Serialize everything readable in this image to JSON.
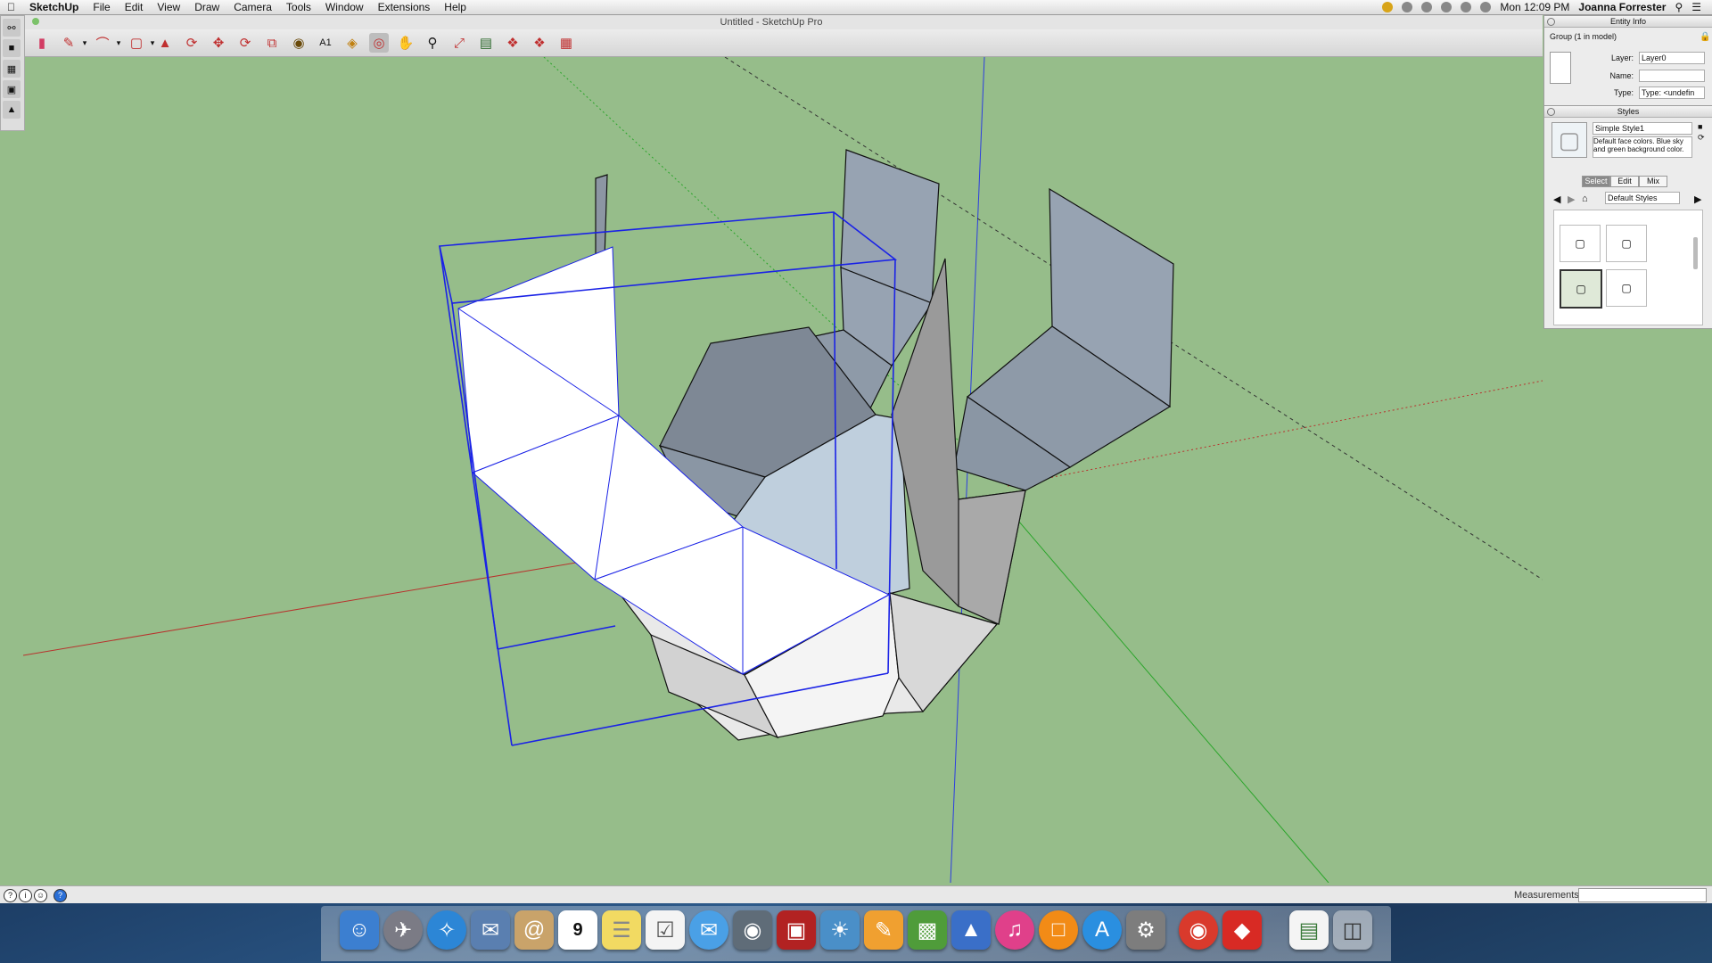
{
  "menubar": {
    "apple": "",
    "app_name": "SketchUp",
    "items": [
      "File",
      "Edit",
      "View",
      "Draw",
      "Camera",
      "Tools",
      "Window",
      "Extensions",
      "Help"
    ],
    "clock": "Mon 12:09 PM",
    "user": "Joanna Forrester"
  },
  "window": {
    "title": "Untitled - SketchUp Pro"
  },
  "entity_info": {
    "panel_title": "Entity Info",
    "selection": "Group (1 in model)",
    "layer_label": "Layer:",
    "layer_value": "Layer0",
    "name_label": "Name:",
    "name_value": "",
    "type_label": "Type:",
    "type_value": "Type: <undefin"
  },
  "styles": {
    "panel_title": "Styles",
    "style_name": "Simple Style1",
    "description": "Default face colors. Blue sky and green background color.",
    "tabs": [
      "Select",
      "Edit",
      "Mix"
    ],
    "active_tab": "Select",
    "collection": "Default Styles"
  },
  "statusbar": {
    "measurements_label": "Measurements",
    "measurements_value": ""
  },
  "colors": {
    "background": "#96bd8a",
    "selection": "#1a22e6",
    "axis_red": "#b8322d",
    "axis_green": "#2aa52a",
    "axis_blue": "#2c3de0"
  },
  "dock": [
    "finder-icon",
    "launchpad-icon",
    "safari-icon",
    "mail-icon",
    "contacts-icon",
    "calendar-icon",
    "notes-icon",
    "reminders-icon",
    "messages-icon",
    "facetime-icon",
    "photo-booth-icon",
    "iphoto-icon",
    "pages-icon",
    "numbers-icon",
    "keynote-icon",
    "itunes-icon",
    "ibooks-icon",
    "app-store-icon",
    "system-preferences-icon",
    "chrome-icon",
    "sketchup-icon",
    "document-icon",
    "trash-icon"
  ],
  "calendar_day": "9"
}
